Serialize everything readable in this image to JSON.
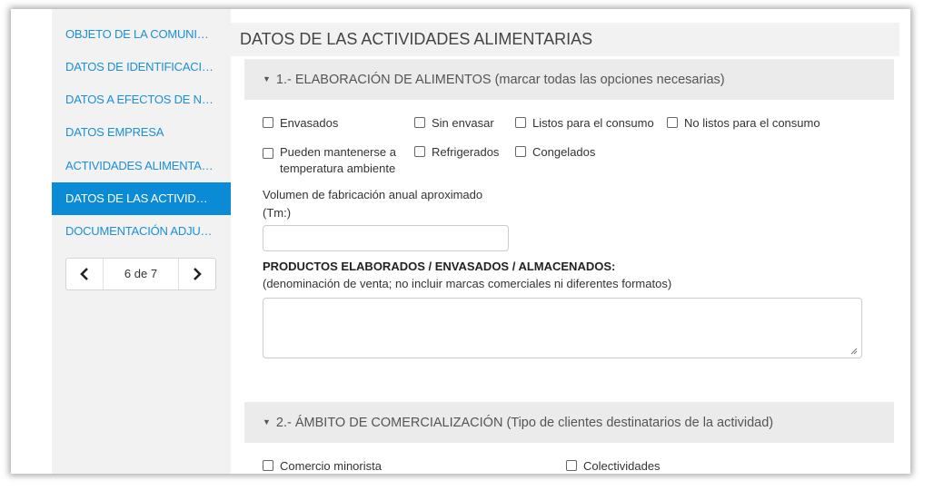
{
  "sidebar": {
    "items": [
      {
        "label": "OBJETO DE LA COMUNI…",
        "active": false
      },
      {
        "label": "DATOS DE IDENTIFICACI…",
        "active": false
      },
      {
        "label": "DATOS A EFECTOS DE N…",
        "active": false
      },
      {
        "label": "DATOS EMPRESA",
        "active": false
      },
      {
        "label": "ACTIVIDADES ALIMENTA…",
        "active": false
      },
      {
        "label": "DATOS DE LAS ACTIVID…",
        "active": true
      },
      {
        "label": "DOCUMENTACIÓN ADJU…",
        "active": false
      }
    ],
    "pager": {
      "info": "6 de 7",
      "prev_icon": "chevron-left-icon",
      "next_icon": "chevron-right-icon"
    }
  },
  "main": {
    "title": "DATOS DE LAS ACTIVIDADES ALIMENTARIAS",
    "section1": {
      "title": "1.- ELABORACIÓN DE ALIMENTOS (marcar todas las opciones necesarias)",
      "checkboxes_row1": [
        "Envasados",
        "Sin envasar",
        "Listos para el consumo",
        "No listos para el consumo"
      ],
      "checkbox_temp_line1": "Pueden mantenerse a",
      "checkbox_temp_line2": "temperatura ambiente",
      "checkbox_refrigerados": "Refrigerados",
      "checkbox_congelados": "Congelados",
      "volume_label_line1": "Volumen de fabricación anual aproximado",
      "volume_label_line2": "(Tm:)",
      "volume_value": "",
      "products_label": "PRODUCTOS ELABORADOS / ENVASADOS / ALMACENADOS:",
      "products_hint": "(denominación de venta; no incluir marcas comerciales ni diferentes formatos)",
      "products_value": ""
    },
    "section2": {
      "title": "2.- ÁMBITO DE COMERCIALIZACIÓN (Tipo de clientes destinatarios de la actividad)",
      "checkboxes": [
        "Comercio minorista",
        "Colectividades"
      ]
    }
  },
  "colors": {
    "accent": "#0b8ad6",
    "link": "#1a8fd6",
    "panel": "#f2f2f2"
  }
}
